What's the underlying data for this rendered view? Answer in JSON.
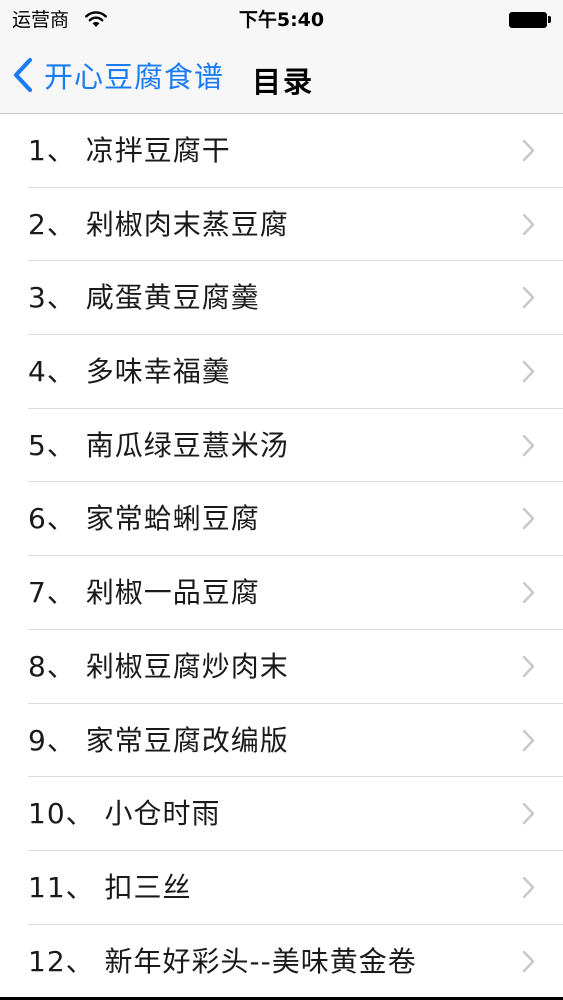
{
  "status_bar": {
    "carrier": "运营商",
    "time": "下午5:40"
  },
  "nav": {
    "back_label": "开心豆腐食谱",
    "title": "目录"
  },
  "icons": {
    "wifi": "wifi-icon",
    "battery": "battery-icon",
    "back": "chevron-left-icon",
    "disclosure": "chevron-right-icon"
  },
  "colors": {
    "accent": "#1a7cf5",
    "bar_background": "#f7f7f7",
    "separator": "#dcdcdf",
    "chevron": "#c7c7cc"
  },
  "list": {
    "items": [
      {
        "label": "1、 凉拌豆腐干"
      },
      {
        "label": "2、 剁椒肉末蒸豆腐"
      },
      {
        "label": "3、 咸蛋黄豆腐羹"
      },
      {
        "label": "4、 多味幸福羹"
      },
      {
        "label": "5、 南瓜绿豆薏米汤"
      },
      {
        "label": "6、 家常蛤蜊豆腐"
      },
      {
        "label": "7、 剁椒一品豆腐"
      },
      {
        "label": "8、 剁椒豆腐炒肉末"
      },
      {
        "label": "9、 家常豆腐改编版"
      },
      {
        "label": "10、 小仓时雨"
      },
      {
        "label": "11、 扣三丝"
      },
      {
        "label": "12、 新年好彩头--美味黄金卷"
      }
    ]
  }
}
